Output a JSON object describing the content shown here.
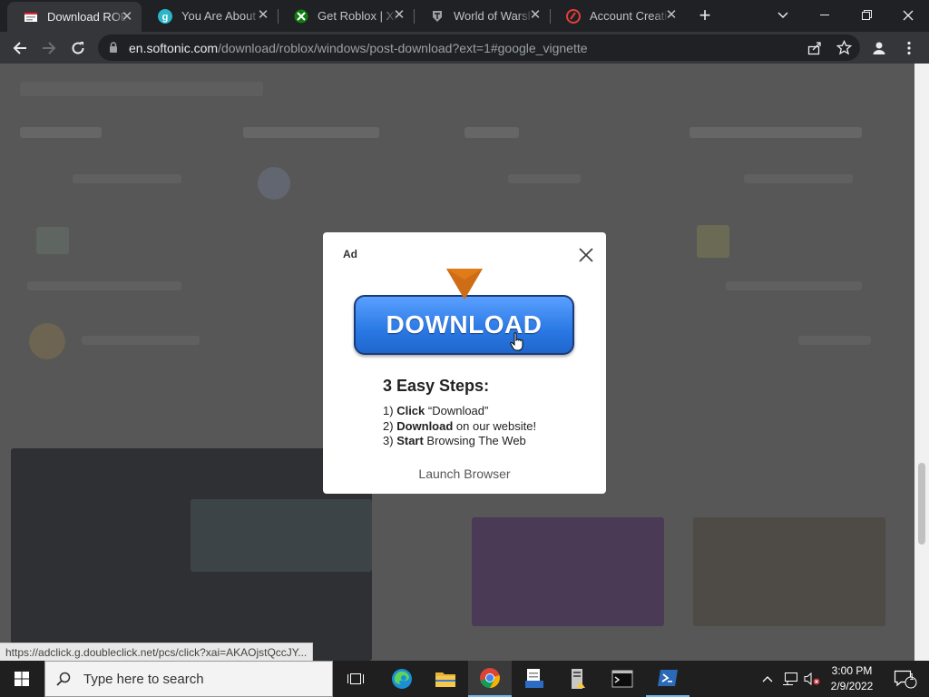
{
  "browser": {
    "tabs": [
      {
        "title": "Download ROBLOX",
        "icon": "softonic-favicon-icon",
        "active": true
      },
      {
        "title": "You Are About to",
        "icon": "g-favicon-icon",
        "active": false
      },
      {
        "title": "Get Roblox | Xbox",
        "icon": "xbox-favicon-icon",
        "active": false
      },
      {
        "title": "World of Warships",
        "icon": "warships-favicon-icon",
        "active": false
      },
      {
        "title": "Account Creation",
        "icon": "red-favicon-icon",
        "active": false
      }
    ],
    "new_tab_label": "+",
    "address": {
      "host": "en.softonic.com",
      "path": "/download/roblox/windows/post-download?ext=1#google_vignette"
    }
  },
  "ad": {
    "label": "Ad",
    "button_label": "DOWNLOAD",
    "steps_title": "3 Easy Steps:",
    "steps": [
      {
        "num": "1)",
        "bold": "Click",
        "rest": " “Download”"
      },
      {
        "num": "2)",
        "bold": "Download",
        "rest": " on our website!"
      },
      {
        "num": "3)",
        "bold": "Start",
        "rest": " Browsing The Web"
      }
    ],
    "launch_label": "Launch Browser"
  },
  "status_link": "https://adclick.g.doubleclick.net/pcs/click?xai=AKAOjstQccJY...",
  "taskbar": {
    "search_placeholder": "Type here to search",
    "clock_time": "3:00 PM",
    "clock_date": "2/9/2022",
    "notification_count": "1"
  },
  "colors": {
    "download_button": "#2a78e4",
    "arrow": "#e07b1a",
    "chrome_dark": "#202124"
  }
}
